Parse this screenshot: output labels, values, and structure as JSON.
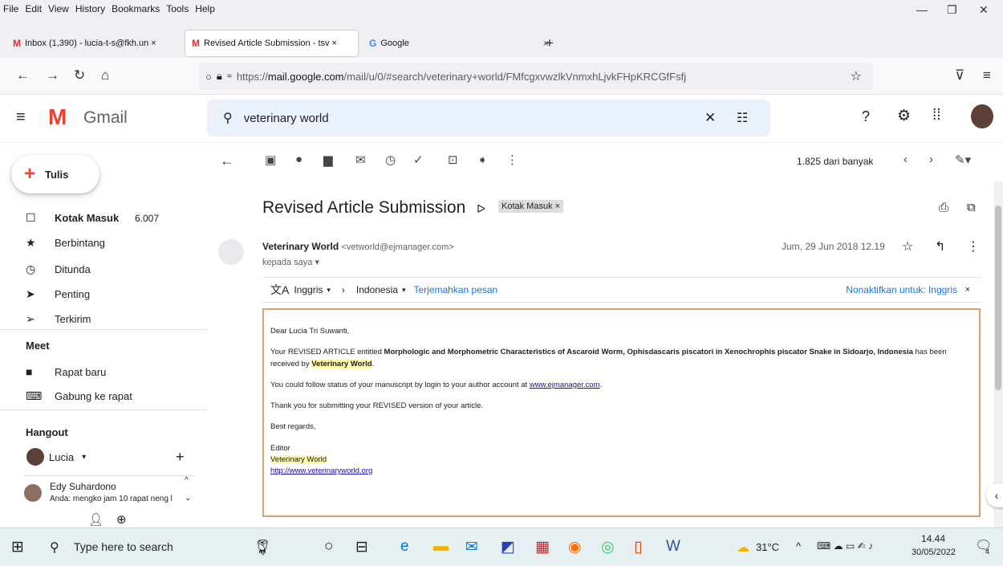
{
  "browser": {
    "menu": [
      "File",
      "Edit",
      "View",
      "History",
      "Bookmarks",
      "Tools",
      "Help"
    ],
    "tabs": [
      {
        "label": "Inbox (1,390) - lucia-t-s@fkh.un ×"
      },
      {
        "label": "Revised Article Submission - tsv ×"
      },
      {
        "label": "Google"
      }
    ],
    "url_prefix": "https://",
    "url_host": "mail.google.com",
    "url_path": "/mail/u/0/#search/veterinary+world/FMfcgxvwzlkVnmxhLjvkFHpKRCGfFsfj"
  },
  "gmail": {
    "logo_text": "Gmail",
    "search_value": "veterinary world",
    "compose_label": "Tulis",
    "nav": [
      {
        "label": "Kotak Masuk",
        "count": "6.007"
      },
      {
        "label": "Berbintang"
      },
      {
        "label": "Ditunda"
      },
      {
        "label": "Penting"
      },
      {
        "label": "Terkirim"
      }
    ],
    "meet_title": "Meet",
    "meet_items": [
      "Rapat baru",
      "Gabung ke rapat"
    ],
    "hangout_title": "Hangout",
    "hangout_user": "Lucia",
    "chat_name": "Edy Suhardono",
    "chat_preview": "Anda: mengko jam 10 rapat neng l",
    "pagination": "1.825 dari banyak"
  },
  "email": {
    "subject": "Revised Article Submission",
    "label": "Kotak Masuk",
    "sender_name": "Veterinary World",
    "sender_email": "<vetworld@ejmanager.com>",
    "to": "kepada saya",
    "date": "Jum, 29 Jun 2018 12.19",
    "translate_from": "Inggris",
    "translate_to": "Indonesia",
    "translate_action": "Terjemahkan pesan",
    "translate_disable": "Nonaktifkan untuk: Inggris",
    "greeting": "Dear Lucia Tri Suwanti,",
    "body1_pre": "Your REVISED ARTICLE entitled ",
    "body1_title": "Morphologic and Morphometric Characteristics of Ascaroid Worm, Ophisdascaris piscatori in Xenochrophis piscator Snake in Sidoarjo, Indonesia",
    "body1_mid": " has been received by ",
    "body1_journal": "Veterinary World",
    "body2_pre": "You could follow status of your manuscript by login to your author account at ",
    "body2_link": "www.ejmanager.com",
    "body3": "Thank you for submitting your REVISED version of your article.",
    "regards": "Best regards,",
    "sig_role": "Editor",
    "sig_journal": "Veterinary World",
    "sig_url": "http://www.veterinaryworld.org"
  },
  "taskbar": {
    "search_placeholder": "Type here to search",
    "weather": "31°C",
    "time": "14.44",
    "date": "30/05/2022",
    "notif_count": "4"
  }
}
